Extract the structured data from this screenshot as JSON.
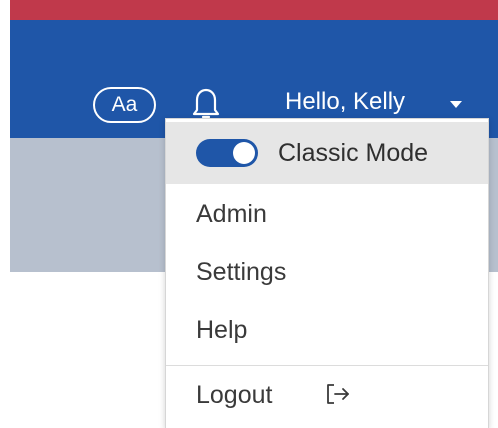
{
  "header": {
    "font_size_label": "Aa",
    "greeting": "Hello, Kelly",
    "icons": {
      "notifications": "bell-icon",
      "user_menu": "chevron-down-icon"
    }
  },
  "menu": {
    "mode_toggle": {
      "label": "Classic Mode",
      "on": true
    },
    "items": [
      {
        "label": "Admin"
      },
      {
        "label": "Settings"
      },
      {
        "label": "Help"
      }
    ],
    "logout": {
      "label": "Logout",
      "icon": "logout-icon"
    }
  },
  "colors": {
    "brand_blue": "#1f56a8",
    "accent_red": "#c0394b",
    "subheader_gray": "#b7c0ce",
    "selected_row": "#e6e6e6"
  }
}
